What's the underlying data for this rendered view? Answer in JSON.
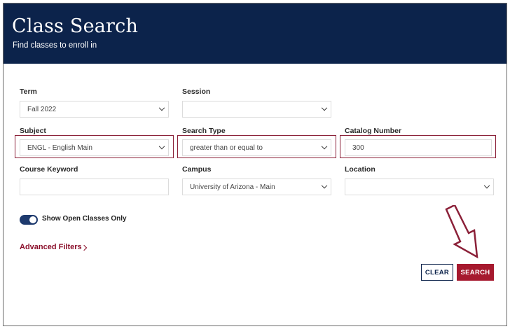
{
  "header": {
    "title": "Class Search",
    "subtitle": "Find classes to enroll in"
  },
  "form": {
    "term": {
      "label": "Term",
      "value": "Fall 2022"
    },
    "session": {
      "label": "Session",
      "value": ""
    },
    "subject": {
      "label": "Subject",
      "value": "ENGL - English Main"
    },
    "search_type": {
      "label": "Search Type",
      "value": "greater than or equal to"
    },
    "catalog_number": {
      "label": "Catalog Number",
      "value": "300"
    },
    "course_keyword": {
      "label": "Course Keyword",
      "value": ""
    },
    "campus": {
      "label": "Campus",
      "value": "University of Arizona - Main"
    },
    "location": {
      "label": "Location",
      "value": ""
    }
  },
  "toggle": {
    "label": "Show Open Classes Only",
    "on": true
  },
  "advanced": {
    "label": "Advanced Filters"
  },
  "buttons": {
    "clear": "CLEAR",
    "search": "SEARCH"
  },
  "colors": {
    "header_bg": "#0c234b",
    "accent": "#a6192e",
    "highlight": "#8b2038"
  },
  "icons": {
    "dropdown": "chevron-down-icon",
    "advanced": "chevron-right-icon",
    "callout": "arrow-down-outline-icon"
  }
}
